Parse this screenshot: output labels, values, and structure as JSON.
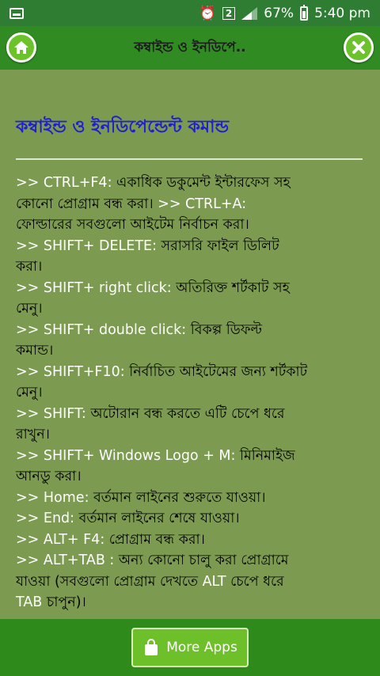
{
  "status_bar": {
    "sim": "2",
    "battery": "67%",
    "time": "5:40 pm"
  },
  "header": {
    "title": "কম্বাইন্ড ও ইনডিপে..",
    "home_icon": "home-icon",
    "close_icon": "close-icon"
  },
  "content": {
    "heading": "কম্বাইন্ড ও ইনডিপেন্ডেন্ট কমান্ড",
    "lines": [
      ">> CTRL+F4: একাধিক ডকুমেন্ট ইন্টারফেস সহ",
      "কোনো প্রোগ্রাম বন্ধ করা। >> CTRL+A:",
      "ফোল্ডারের সবগুলো আইটেম নির্বাচন করা।",
      ">> SHIFT+ DELETE: সরাসরি ফাইল ডিলিট",
      "করা।",
      ">> SHIFT+ right click: অতিরিক্ত শর্টকাট সহ",
      "মেনু।",
      ">> SHIFT+ double click: বিকল্প ডিফল্ট",
      "কমান্ড।",
      ">> SHIFT+F10: নির্বাচিত আইটেমের জন্য শর্টকাট",
      "মেনু।",
      ">> SHIFT: অটোরান বন্ধ করতে এটি চেপে ধরে",
      "রাখুন।",
      ">> SHIFT+ Windows Logo + M: মিনিমাইজ",
      "আনডু করা।",
      ">> Home: বর্তমান লাইনের শুরুতে যাওয়া।",
      ">> End: বর্তমান লাইনের শেষে যাওয়া।",
      ">> ALT+ F4: প্রোগ্রাম বন্ধ করা।",
      ">> ALT+TAB : অন্য কোনো চালু করা প্রোগ্রামে",
      "যাওয়া (সবগুলো প্রোগ্রাম দেখতে ALT চেপে ধরে",
      "TAB চাপুন)।"
    ]
  },
  "footer": {
    "more_apps_label": "More Apps",
    "icon": "shopping-bag-icon"
  },
  "colors": {
    "status_bar": "#2e7d32",
    "title_bar": "#2f8b22",
    "content_bg": "#7c9b50",
    "heading": "#1f1fd0",
    "button": "#6bc22a"
  }
}
